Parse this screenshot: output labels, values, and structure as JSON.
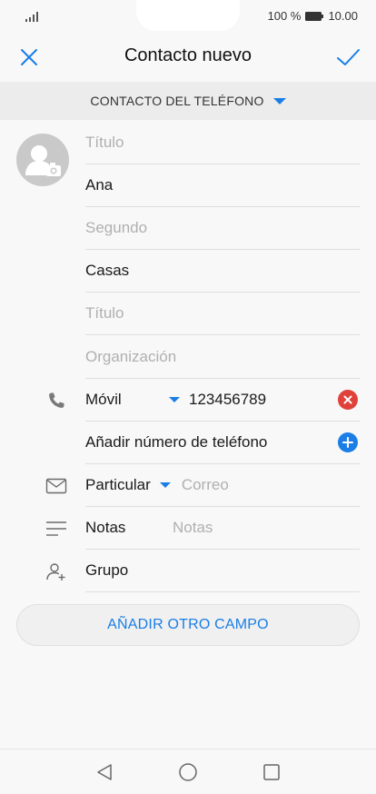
{
  "status": {
    "battery_pct": "100 %",
    "time": "10.00"
  },
  "header": {
    "title": "Contacto nuevo"
  },
  "account": {
    "label": "CONTACTO DEL TELÉFONO"
  },
  "fields": {
    "prefix": "Título",
    "first_name": "Ana",
    "middle_name": "Segundo",
    "last_name": "Casas",
    "suffix": "Título",
    "organization": "Organización"
  },
  "phone": {
    "type": "Móvil",
    "number": "123456789",
    "add_label": "Añadir número de teléfono"
  },
  "email": {
    "type": "Particular",
    "placeholder": "Correo"
  },
  "notes": {
    "label": "Notas",
    "placeholder": "Notas"
  },
  "group": {
    "label": "Grupo"
  },
  "actions": {
    "add_field": "AÑADIR OTRO CAMPO"
  },
  "colors": {
    "accent": "#1a7ee6",
    "clear": "#e0413a",
    "avatar": "#c9c9c9"
  }
}
